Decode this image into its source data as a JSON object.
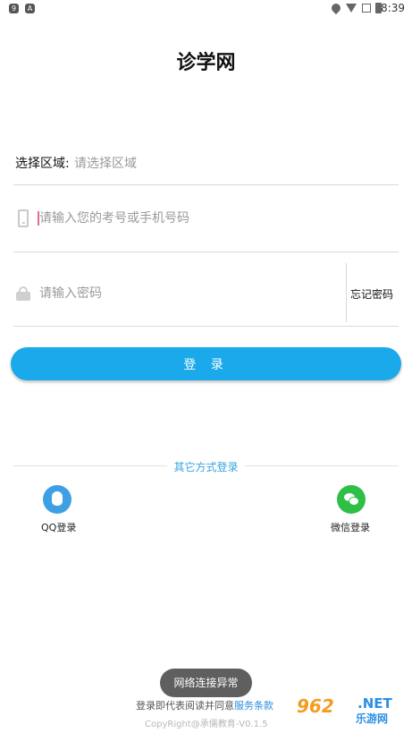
{
  "status_bar": {
    "time": "8:39",
    "left_icons": [
      "9",
      "A"
    ]
  },
  "title": "诊学网",
  "region": {
    "label": "选择区域:",
    "placeholder": "请选择区域"
  },
  "phone": {
    "placeholder": "请输入您的考号或手机号码"
  },
  "password": {
    "placeholder": "请输入密码",
    "forgot_label": "忘记密码"
  },
  "login": {
    "label": "登 录"
  },
  "other_login": {
    "label": "其它方式登录",
    "qq_label": "QQ登录",
    "wechat_label": "微信登录"
  },
  "toast": "网络连接异常",
  "footer": {
    "agreement_prefix": "登录即代表阅读并同意",
    "agreement_link": "服务条款",
    "copyright": "CopyRight@承儒教育-V0.1.5"
  },
  "watermark": {
    "number": "962",
    "net": ".NET",
    "site": "乐游网"
  },
  "colors": {
    "accent": "#1aa9ea",
    "link": "#2c8de0",
    "qq": "#3ea0e4",
    "wechat": "#2fbf46"
  }
}
